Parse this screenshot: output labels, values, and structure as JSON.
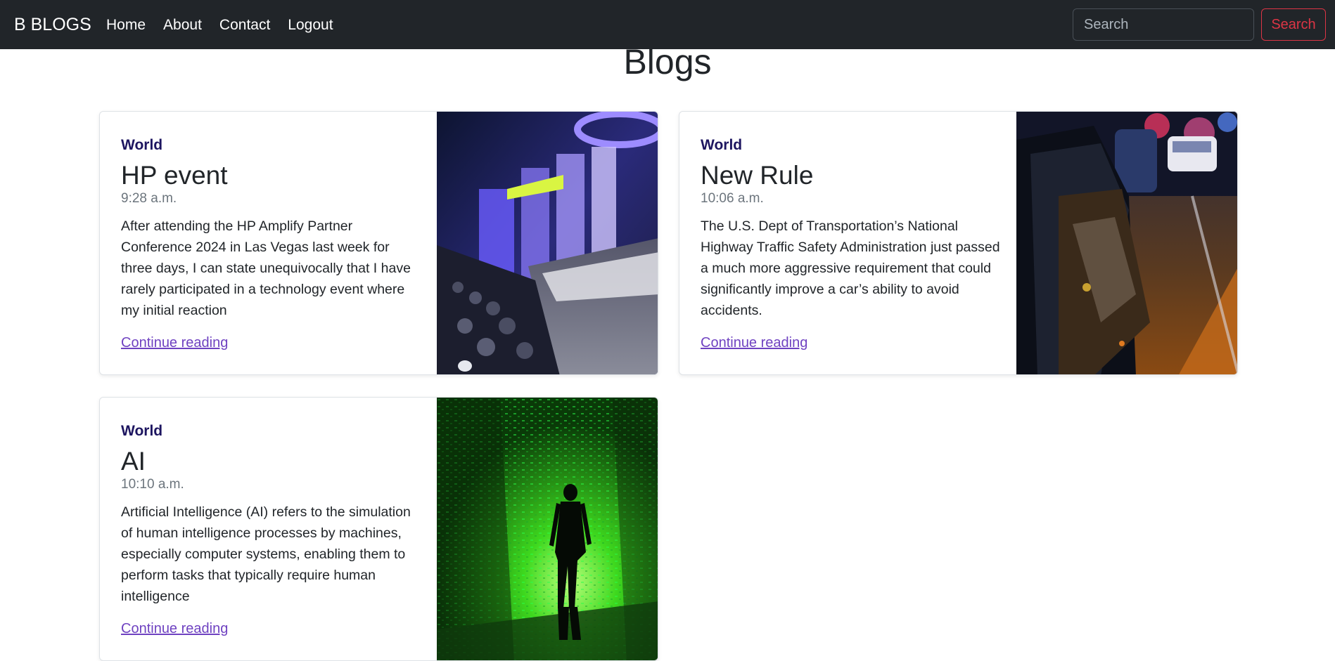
{
  "navbar": {
    "brand": "B BLOGS",
    "links": [
      "Home",
      "About",
      "Contact",
      "Logout"
    ],
    "search_placeholder": "Search",
    "search_button": "Search"
  },
  "page": {
    "title": "Blogs"
  },
  "posts": [
    {
      "category": "World",
      "title": "HP event",
      "time": "9:28 a.m.",
      "excerpt": "After attending the HP Amplify Partner Conference 2024 in Las Vegas last week for three days, I can state unequivocally that I have rarely participated in a technology event where my initial reaction",
      "link": "Continue reading",
      "image": "conference-stage-image"
    },
    {
      "category": "World",
      "title": "New Rule",
      "time": "10:06 a.m.",
      "excerpt": "The U.S. Dept of Transportation’s National Highway Traffic Safety Administration just passed a much more aggressive requirement that could significantly improve a car’s ability to avoid accidents.",
      "link": "Continue reading",
      "image": "car-crash-image"
    },
    {
      "category": "World",
      "title": "AI",
      "time": "10:10 a.m.",
      "excerpt": "Artificial Intelligence (AI) refers to the simulation of human intelligence processes by machines, especially computer systems, enabling them to perform tasks that typically require human intelligence",
      "link": "Continue reading",
      "image": "digital-matrix-figure-image"
    }
  ],
  "colors": {
    "navbar_bg": "#212529",
    "search_button": "#dc3545",
    "category": "#1d1560",
    "link": "#6f42c1"
  }
}
